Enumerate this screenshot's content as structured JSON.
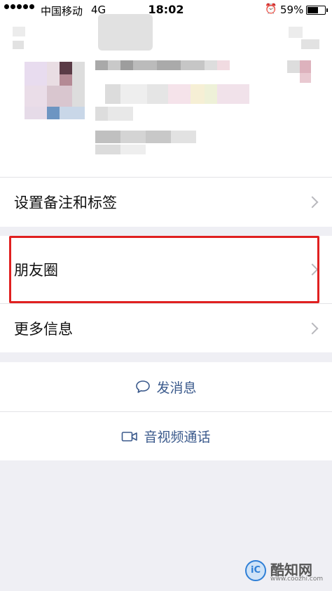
{
  "status_bar": {
    "signal_dots": 5,
    "carrier": "中国移动",
    "network": "4G",
    "time": "18:02",
    "alarm_icon": "alarm-icon",
    "battery": "59%"
  },
  "menu": {
    "remark_label": "设置备注和标签",
    "moments_label": "朋友圈",
    "more_info_label": "更多信息"
  },
  "actions": {
    "message_label": "发消息",
    "video_call_label": "音视频通话"
  },
  "colors": {
    "accent": "#3b5a8c",
    "highlight_box": "#e02020",
    "background": "#efeff4"
  },
  "watermark": {
    "name": "酷知网",
    "url": "www.coozhi.com"
  }
}
